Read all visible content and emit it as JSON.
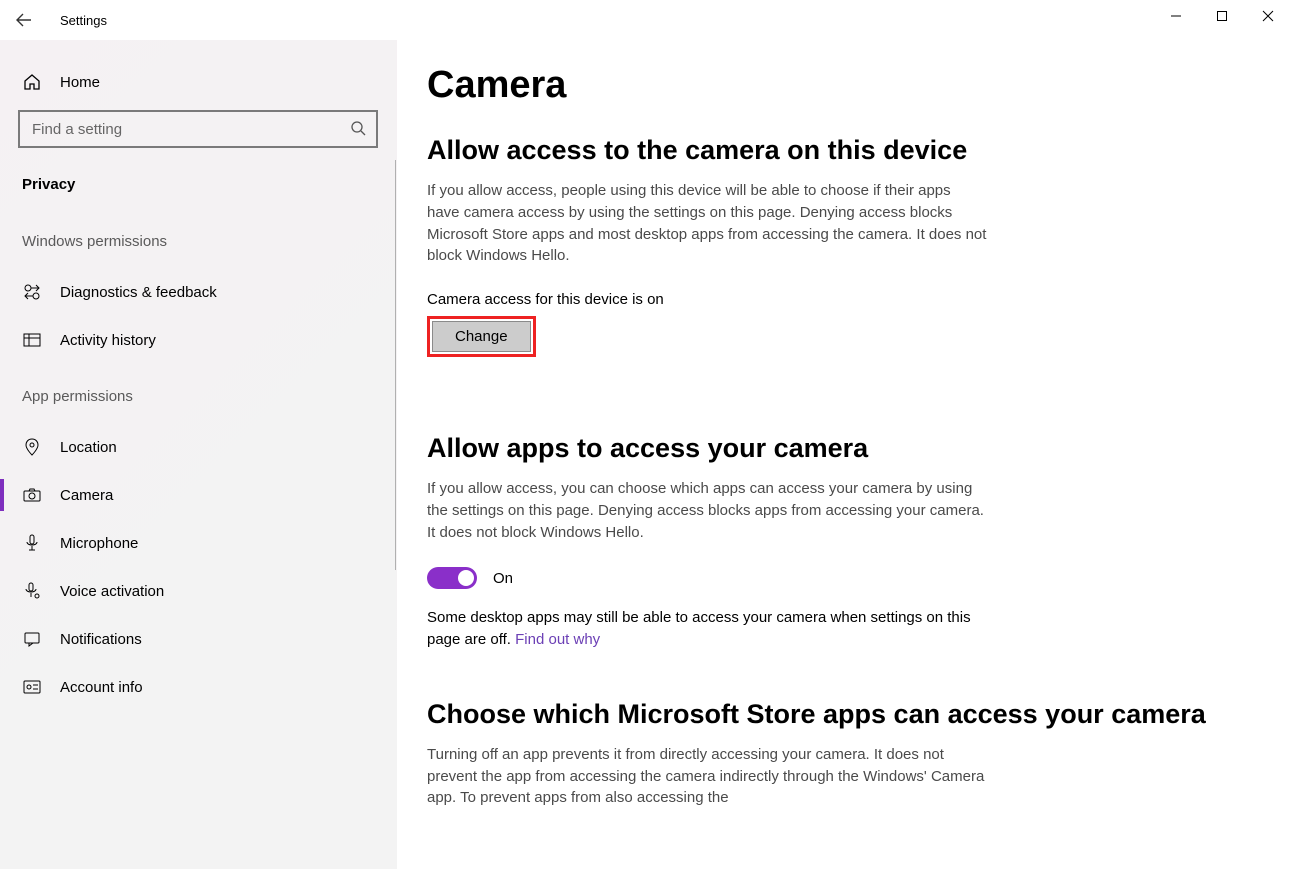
{
  "window": {
    "title": "Settings"
  },
  "sidebar": {
    "home_label": "Home",
    "search_placeholder": "Find a setting",
    "category_label": "Privacy",
    "group_windows": "Windows permissions",
    "group_app": "App permissions",
    "items_windows": [
      {
        "label": "Diagnostics & feedback"
      },
      {
        "label": "Activity history"
      }
    ],
    "items_app": [
      {
        "label": "Location"
      },
      {
        "label": "Camera"
      },
      {
        "label": "Microphone"
      },
      {
        "label": "Voice activation"
      },
      {
        "label": "Notifications"
      },
      {
        "label": "Account info"
      }
    ]
  },
  "main": {
    "page_title": "Camera",
    "section1": {
      "heading": "Allow access to the camera on this device",
      "desc": "If you allow access, people using this device will be able to choose if their apps have camera access by using the settings on this page. Denying access blocks Microsoft Store apps and most desktop apps from accessing the camera. It does not block Windows Hello.",
      "status": "Camera access for this device is on",
      "change_label": "Change"
    },
    "section2": {
      "heading": "Allow apps to access your camera",
      "desc": "If you allow access, you can choose which apps can access your camera by using the settings on this page. Denying access blocks apps from accessing your camera. It does not block Windows Hello.",
      "toggle_label": "On",
      "note_prefix": "Some desktop apps may still be able to access your camera when settings on this page are off. ",
      "note_link": "Find out why"
    },
    "section3": {
      "heading": "Choose which Microsoft Store apps can access your camera",
      "desc": "Turning off an app prevents it from directly accessing your camera. It does not prevent the app from accessing the camera indirectly through the Windows' Camera app. To prevent apps from also accessing the"
    }
  }
}
